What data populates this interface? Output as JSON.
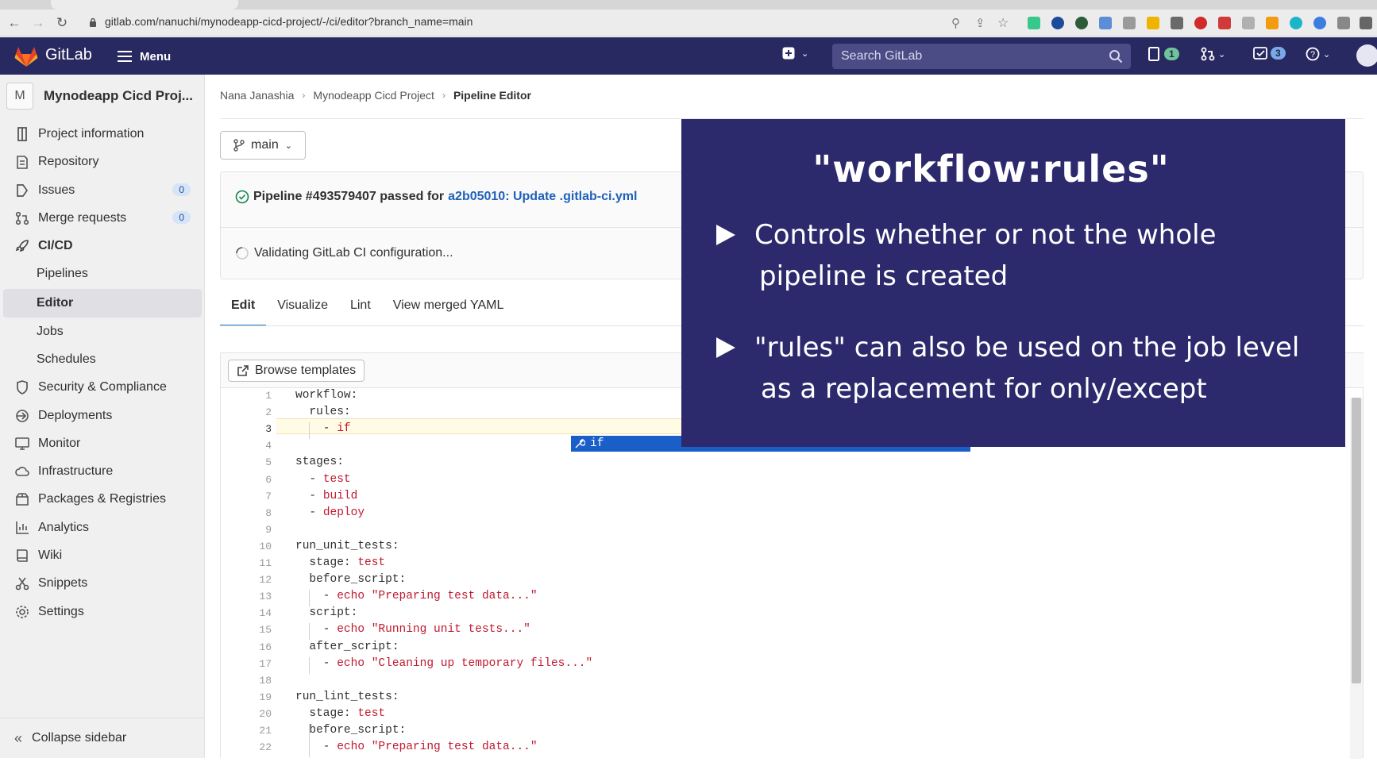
{
  "browser": {
    "url": "gitlab.com/nanuchi/mynodeapp-cicd-project/-/ci/editor?branch_name=main"
  },
  "topbar": {
    "brand": "GitLab",
    "menu_label": "Menu",
    "search_placeholder": "Search GitLab",
    "issues_badge": "1",
    "todos_badge": "3"
  },
  "sidebar": {
    "project_initial": "M",
    "project_name": "Mynodeapp Cicd Proj...",
    "items": [
      {
        "label": "Project information"
      },
      {
        "label": "Repository"
      },
      {
        "label": "Issues",
        "count": "0"
      },
      {
        "label": "Merge requests",
        "count": "0"
      },
      {
        "label": "CI/CD"
      },
      {
        "label": "Pipelines"
      },
      {
        "label": "Editor"
      },
      {
        "label": "Jobs"
      },
      {
        "label": "Schedules"
      },
      {
        "label": "Security & Compliance"
      },
      {
        "label": "Deployments"
      },
      {
        "label": "Monitor"
      },
      {
        "label": "Infrastructure"
      },
      {
        "label": "Packages & Registries"
      },
      {
        "label": "Analytics"
      },
      {
        "label": "Wiki"
      },
      {
        "label": "Snippets"
      },
      {
        "label": "Settings"
      }
    ],
    "collapse_label": "Collapse sidebar"
  },
  "breadcrumb": {
    "user": "Nana Janashia",
    "project": "Mynodeapp Cicd Project",
    "current": "Pipeline Editor"
  },
  "branch": "main",
  "status": {
    "pipeline_text": "Pipeline #493579407 passed for",
    "commit_link": "a2b05010: Update .gitlab-ci.yml",
    "validating": "Validating GitLab CI configuration..."
  },
  "tabs": [
    "Edit",
    "Visualize",
    "Lint",
    "View merged YAML"
  ],
  "editor": {
    "browse_templates": "Browse templates",
    "autocomplete": "if",
    "lines": [
      {
        "n": "1",
        "key": "workflow:",
        "val": ""
      },
      {
        "n": "2",
        "key": "  rules:",
        "val": ""
      },
      {
        "n": "3",
        "key": "    - ",
        "val": "if"
      },
      {
        "n": "4",
        "key": "",
        "val": ""
      },
      {
        "n": "5",
        "key": "stages:",
        "val": ""
      },
      {
        "n": "6",
        "key": "  - ",
        "val": "test"
      },
      {
        "n": "7",
        "key": "  - ",
        "val": "build"
      },
      {
        "n": "8",
        "key": "  - ",
        "val": "deploy"
      },
      {
        "n": "9",
        "key": "",
        "val": ""
      },
      {
        "n": "10",
        "key": "run_unit_tests:",
        "val": ""
      },
      {
        "n": "11",
        "key": "  stage: ",
        "val": "test"
      },
      {
        "n": "12",
        "key": "  before_script:",
        "val": ""
      },
      {
        "n": "13",
        "key": "    - ",
        "val": "echo \"Preparing test data...\""
      },
      {
        "n": "14",
        "key": "  script:",
        "val": ""
      },
      {
        "n": "15",
        "key": "    - ",
        "val": "echo \"Running unit tests...\""
      },
      {
        "n": "16",
        "key": "  after_script:",
        "val": ""
      },
      {
        "n": "17",
        "key": "    - ",
        "val": "echo \"Cleaning up temporary files...\""
      },
      {
        "n": "18",
        "key": "",
        "val": ""
      },
      {
        "n": "19",
        "key": "run_lint_tests:",
        "val": ""
      },
      {
        "n": "20",
        "key": "  stage: ",
        "val": "test"
      },
      {
        "n": "21",
        "key": "  before_script:",
        "val": ""
      },
      {
        "n": "22",
        "key": "    - ",
        "val": "echo \"Preparing test data...\""
      }
    ]
  },
  "overlay": {
    "title": "\"workflow:rules\"",
    "bullet1_line1": "Controls whether or not the whole",
    "bullet1_line2": "pipeline is created",
    "bullet2_line1": "\"rules\" can also be used on the job level",
    "bullet2_line2": "as a replacement for only/except"
  }
}
